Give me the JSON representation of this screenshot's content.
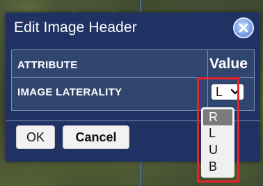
{
  "dialog": {
    "title": "Edit Image Header",
    "close_icon": "close-icon",
    "table": {
      "headers": {
        "attribute": "ATTRIBUTE",
        "value": "Value"
      },
      "rows": [
        {
          "attribute": "IMAGE LATERALITY",
          "value": "L"
        }
      ]
    },
    "buttons": {
      "ok": "OK",
      "cancel": "Cancel"
    }
  },
  "laterality_dropdown": {
    "options": [
      "R",
      "L",
      "U",
      "B"
    ],
    "highlighted_index": 0
  },
  "colors": {
    "dialog_bg": "#1f3263",
    "table_bg": "#31466f",
    "highlight": "#e8202a"
  }
}
